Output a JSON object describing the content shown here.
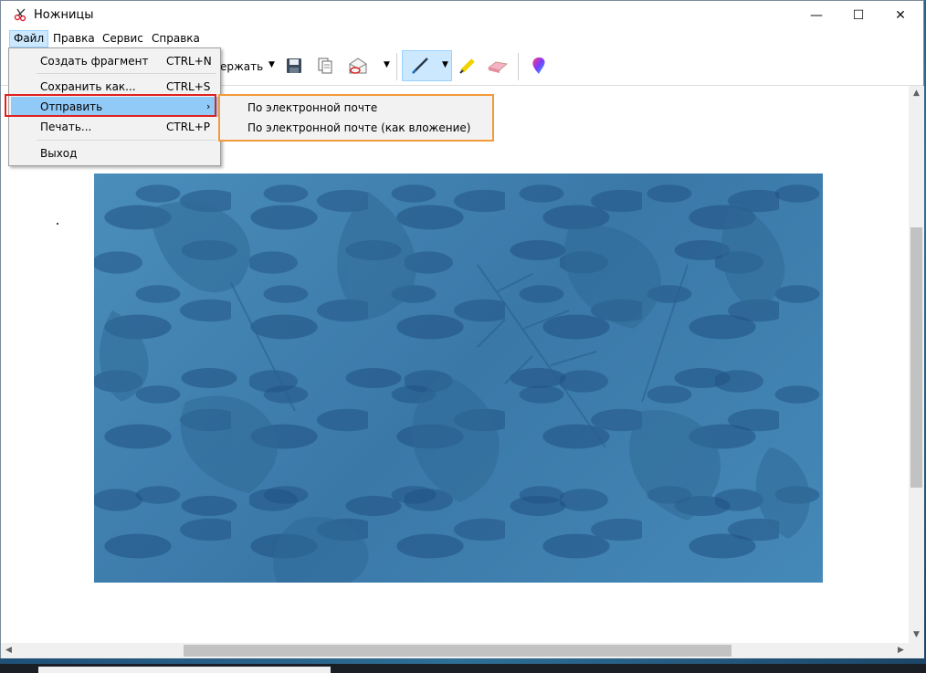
{
  "window": {
    "title": "Ножницы",
    "controls": {
      "minimize": "—",
      "maximize": "☐",
      "close": "✕"
    }
  },
  "menubar": {
    "items": [
      {
        "id": "file",
        "label": "Файл"
      },
      {
        "id": "edit",
        "label": "Правка"
      },
      {
        "id": "service",
        "label": "Сервис"
      },
      {
        "id": "help",
        "label": "Справка"
      }
    ]
  },
  "toolbar": {
    "delay_label": "ержать",
    "dropdown_arrow": "▼",
    "icons": [
      "save-icon",
      "copy-icon",
      "send-snip-icon",
      "pen-icon",
      "highlighter-icon",
      "eraser-icon",
      "paint-3d-icon"
    ]
  },
  "file_menu": {
    "items": [
      {
        "label": "Создать фрагмент",
        "shortcut": "CTRL+N"
      },
      {
        "label": "Сохранить как...",
        "shortcut": "CTRL+S"
      },
      {
        "label": "Отправить",
        "submenu_arrow": "›"
      },
      {
        "label": "Печать...",
        "shortcut": "CTRL+P"
      },
      {
        "label": "Выход"
      }
    ]
  },
  "send_submenu": {
    "items": [
      {
        "label": "По электронной почте"
      },
      {
        "label": "По электронной почте (как вложение)"
      }
    ]
  },
  "scrollbars": {
    "up": "▲",
    "down": "▼",
    "left": "◀",
    "right": "▶"
  },
  "colors": {
    "menu_highlight": "#91c9f7",
    "red_annotation": "#e02020",
    "orange_annotation": "#f39a3a",
    "snip_blue": "#3e7fae"
  }
}
